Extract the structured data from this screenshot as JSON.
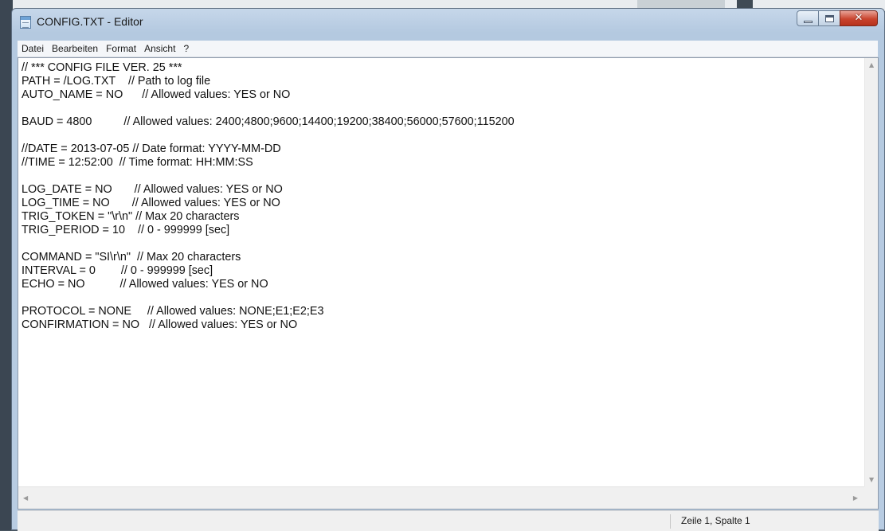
{
  "window": {
    "title": "CONFIG.TXT - Editor"
  },
  "menu": {
    "items": [
      "Datei",
      "Bearbeiten",
      "Format",
      "Ansicht",
      "?"
    ]
  },
  "editor": {
    "lines": [
      "// *** CONFIG FILE VER. 25 ***",
      "PATH = /LOG.TXT    // Path to log file",
      "AUTO_NAME = NO      // Allowed values: YES or NO",
      "",
      "BAUD = 4800          // Allowed values: 2400;4800;9600;14400;19200;38400;56000;57600;115200",
      "",
      "//DATE = 2013-07-05 // Date format: YYYY-MM-DD",
      "//TIME = 12:52:00  // Time format: HH:MM:SS",
      "",
      "LOG_DATE = NO       // Allowed values: YES or NO",
      "LOG_TIME = NO       // Allowed values: YES or NO",
      "TRIG_TOKEN = \"\\r\\n\" // Max 20 characters",
      "TRIG_PERIOD = 10    // 0 - 999999 [sec]",
      "",
      "COMMAND = \"SI\\r\\n\"  // Max 20 characters",
      "INTERVAL = 0        // 0 - 999999 [sec]",
      "ECHO = NO           // Allowed values: YES or NO",
      "",
      "PROTOCOL = NONE     // Allowed values: NONE;E1;E2;E3",
      "CONFIRMATION = NO   // Allowed values: YES or NO"
    ]
  },
  "statusbar": {
    "position": "Zeile 1, Spalte 1"
  },
  "colors": {
    "title_gradient_top": "#c6d7ea",
    "close_button": "#c9442e",
    "editor_bg": "#ffffff"
  }
}
